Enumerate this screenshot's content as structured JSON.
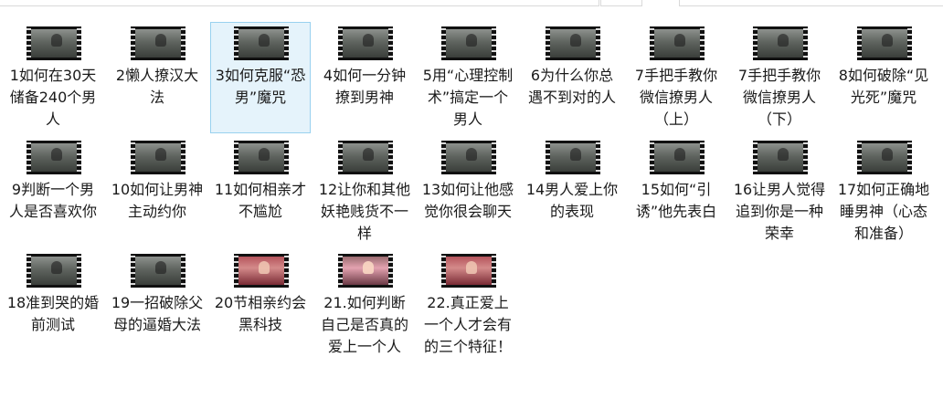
{
  "files": [
    {
      "label": "1如何在30天储备240个男人",
      "thumb": "bw"
    },
    {
      "label": "2懒人撩汉大法",
      "thumb": "bw"
    },
    {
      "label": "3如何克服“恐男”魔咒",
      "thumb": "bw",
      "selected": true
    },
    {
      "label": "4如何一分钟撩到男神",
      "thumb": "bw"
    },
    {
      "label": "5用“心理控制术”搞定一个男人",
      "thumb": "bw"
    },
    {
      "label": "6为什么你总遇不到对的人",
      "thumb": "bw"
    },
    {
      "label": "7手把手教你微信撩男人（上）",
      "thumb": "bw"
    },
    {
      "label": "7手把手教你微信撩男人（下）",
      "thumb": "bw"
    },
    {
      "label": "8如何破除“见光死”魔咒",
      "thumb": "bw"
    },
    {
      "label": "9判断一个男人是否喜欢你",
      "thumb": "bw"
    },
    {
      "label": "10如何让男神主动约你",
      "thumb": "bw"
    },
    {
      "label": "11如何相亲才不尴尬",
      "thumb": "bw"
    },
    {
      "label": "12让你和其他妖艳贱货不一样",
      "thumb": "bw"
    },
    {
      "label": "13如何让他感觉你很会聊天",
      "thumb": "bw"
    },
    {
      "label": "14男人爱上你的表现",
      "thumb": "bw"
    },
    {
      "label": "15如何“引诱”他先表白",
      "thumb": "bw"
    },
    {
      "label": "16让男人觉得追到你是一种荣幸",
      "thumb": "bw"
    },
    {
      "label": "17如何正确地睡男神（心态和准备）",
      "thumb": "bw"
    },
    {
      "label": "18准到哭的婚前测试",
      "thumb": "bw"
    },
    {
      "label": "19一招破除父母的逼婚大法",
      "thumb": "bw"
    },
    {
      "label": "20节相亲约会黑科技",
      "thumb": "color"
    },
    {
      "label": "21.如何判断自己是否真的爱上一个人",
      "thumb": "color2"
    },
    {
      "label": "22.真正爱上一个人才会有的三个特征！",
      "thumb": "color"
    }
  ]
}
